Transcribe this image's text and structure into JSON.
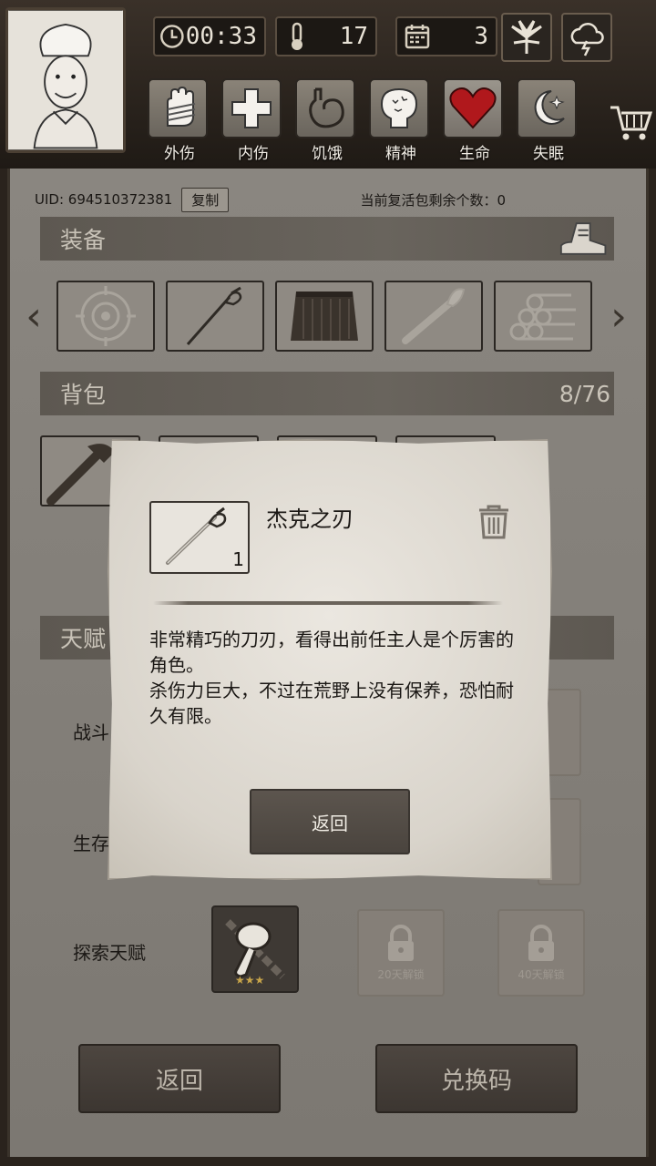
{
  "header": {
    "time": "00:33",
    "temperature": "17",
    "day": "3",
    "status_labels": [
      "外伤",
      "内伤",
      "饥饿",
      "精神",
      "生命",
      "失眠"
    ]
  },
  "account": {
    "uid": "UID: 694510372381",
    "copy_label": "复制",
    "revive_text": "当前复活包剩余个数：0"
  },
  "equipment": {
    "title": "装备",
    "slots": [
      "target-icon",
      "sword-icon",
      "skirt-icon",
      "torch-icon",
      "logs-icon"
    ]
  },
  "backpack": {
    "title": "背包",
    "capacity": "8/76"
  },
  "talents": {
    "title": "天赋",
    "rows": [
      "战斗",
      "生存",
      "探索天赋"
    ],
    "lock_labels": [
      "20天解锁",
      "40天解锁"
    ],
    "active_stars": 3
  },
  "footer": {
    "back_label": "返回",
    "redeem_label": "兑换码"
  },
  "dialog": {
    "item_name": "杰克之刃",
    "item_count": "1",
    "desc_line1": "非常精巧的刀刃，看得出前任主人是个厉害的角色。",
    "desc_line2": "杀伤力巨大，不过在荒野上没有保养，恐怕耐久有限。",
    "back_label": "返回"
  },
  "colors": {
    "heart": "#b0181c",
    "panel": "#847f78",
    "dialog_paper": "#e2ded6"
  }
}
